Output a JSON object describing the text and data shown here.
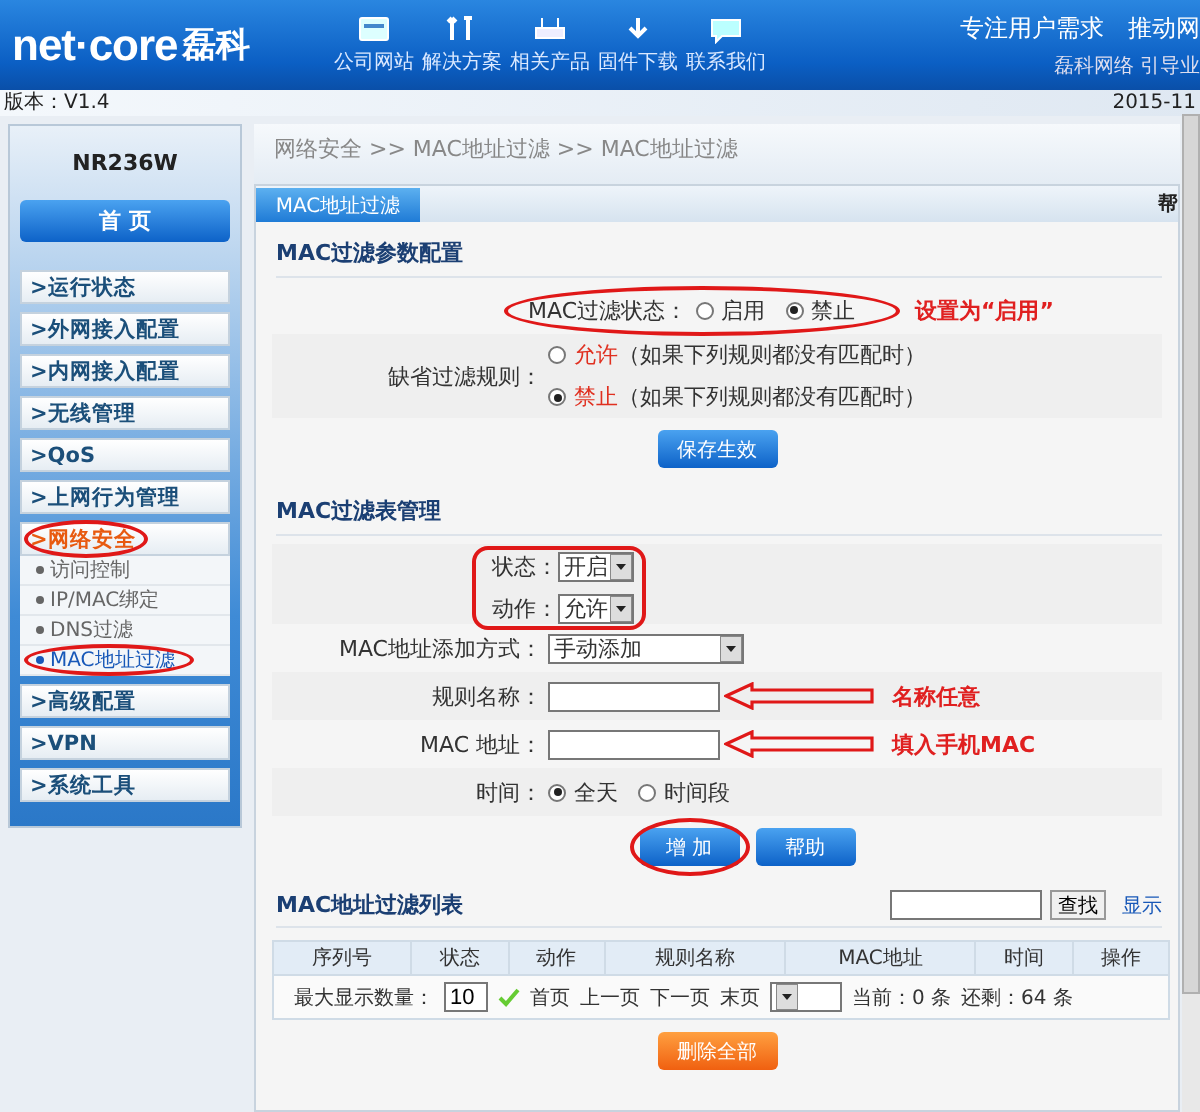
{
  "header": {
    "logo": "net·core",
    "logo_cn": "磊科",
    "nav": [
      {
        "label": "公司网站",
        "kind": "site"
      },
      {
        "label": "解决方案",
        "kind": "tools"
      },
      {
        "label": "相关产品",
        "kind": "product"
      },
      {
        "label": "固件下载",
        "kind": "download"
      },
      {
        "label": "联系我们",
        "kind": "chat"
      }
    ],
    "slogan": "专注用户需求",
    "slogan_2": "推动网",
    "slogan_sub": "磊科网络 引导业"
  },
  "version_bar": {
    "version": "版本：V1.4",
    "date": "2015-11"
  },
  "sidebar": {
    "model": "NR236W",
    "home": "首 页",
    "items": [
      {
        "label": ">运行状态",
        "expanded": false,
        "circled": false
      },
      {
        "label": ">外网接入配置",
        "expanded": false,
        "circled": false
      },
      {
        "label": ">内网接入配置",
        "expanded": false,
        "circled": false
      },
      {
        "label": ">无线管理",
        "expanded": false,
        "circled": false
      },
      {
        "label": ">QoS",
        "expanded": false,
        "circled": false
      },
      {
        "label": ">上网行为管理",
        "expanded": false,
        "circled": false
      },
      {
        "label": ">网络安全",
        "expanded": true,
        "circled": true,
        "children": [
          {
            "label": "访问控制",
            "selected": false,
            "circled": false
          },
          {
            "label": "IP/MAC绑定",
            "selected": false,
            "circled": false
          },
          {
            "label": "DNS过滤",
            "selected": false,
            "circled": false
          },
          {
            "label": "MAC地址过滤",
            "selected": true,
            "circled": true
          }
        ]
      },
      {
        "label": ">高级配置",
        "expanded": false,
        "circled": false
      },
      {
        "label": ">VPN",
        "expanded": false,
        "circled": false
      },
      {
        "label": ">系统工具",
        "expanded": false,
        "circled": false
      }
    ]
  },
  "breadcrumb": "网络安全 >> MAC地址过滤 >> MAC地址过滤",
  "tab": {
    "label": "MAC地址过滤",
    "help": "帮"
  },
  "params": {
    "title": "MAC过滤参数配置",
    "status": {
      "label": "MAC过滤状态：",
      "circled": true,
      "note": "设置为“启用”",
      "options": [
        {
          "label": "启用",
          "selected": false
        },
        {
          "label": "禁止",
          "selected": true
        }
      ]
    },
    "default_rule": {
      "label": "缺省过滤规则：",
      "options": [
        {
          "label": "允许",
          "hint": "（如果下列规则都没有匹配时）",
          "selected": false
        },
        {
          "label": "禁止",
          "hint": "（如果下列规则都没有匹配时）",
          "selected": true
        }
      ]
    },
    "save": "保存生效"
  },
  "table_mgmt": {
    "title": "MAC过滤表管理",
    "selects": {
      "circled": true,
      "items": [
        {
          "label": "状态：",
          "value": "开启"
        },
        {
          "label": "动作：",
          "value": "允许"
        }
      ]
    },
    "method": {
      "label": "MAC地址添加方式：",
      "value": "手动添加"
    },
    "inputs": [
      {
        "label": "规则名称：",
        "note": "名称任意"
      },
      {
        "label": "MAC 地址：",
        "note": "填入手机MAC"
      }
    ],
    "time": {
      "label": "时间：",
      "options": [
        {
          "label": "全天",
          "selected": true
        },
        {
          "label": "时间段",
          "selected": false
        }
      ]
    },
    "buttons": [
      {
        "label": "增 加",
        "circled": true
      },
      {
        "label": "帮助",
        "circled": false
      }
    ]
  },
  "list": {
    "title": "MAC地址过滤列表",
    "search_button": "查找",
    "show": "显示",
    "columns": [
      "序列号",
      "状态",
      "动作",
      "规则名称",
      "MAC地址",
      "时间",
      "操作"
    ],
    "max_label": "最大显示数量：",
    "max_value": "10",
    "pager": [
      "首页",
      "上一页",
      "下一页",
      "末页"
    ],
    "current": "当前：0 条",
    "remaining": "还剩：64 条",
    "delete_all": "删除全部"
  }
}
